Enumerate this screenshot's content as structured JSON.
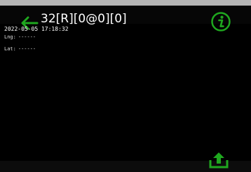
{
  "header": {
    "title": "32[R][0@0][0]",
    "back_icon": "arrow-left-icon",
    "info_icon": "info-icon"
  },
  "info": {
    "datetime": "2022-05-05 17:18:32",
    "lng_label": "Lng:",
    "lng_value": "------",
    "lat_label": "Lat:",
    "lat_value": "------"
  },
  "footer": {
    "upload_icon": "upload-icon"
  },
  "colors": {
    "accent": "#1fa81f",
    "background": "#000000",
    "statusbar": "#b5b5b5"
  }
}
